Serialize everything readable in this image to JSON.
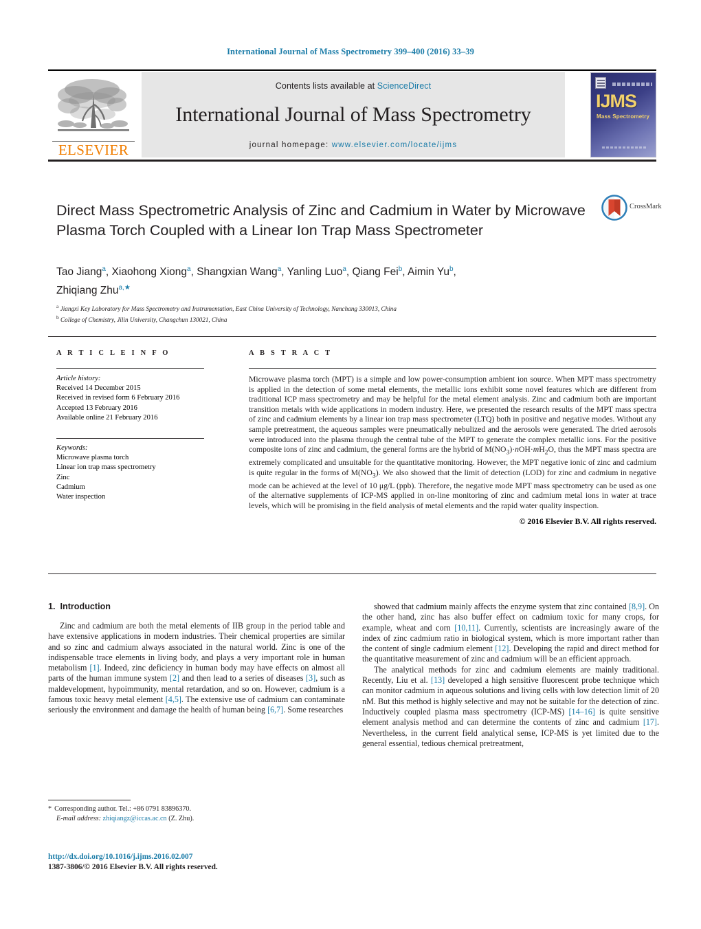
{
  "running_head": "International Journal of Mass Spectrometry 399–400 (2016) 33–39",
  "masthead": {
    "publisher": "ELSEVIER",
    "contents_prefix": "Contents lists available at ",
    "contents_link": "ScienceDirect",
    "journal_name": "International Journal of Mass Spectrometry",
    "homepage_label": "journal homepage: ",
    "homepage_url": "www.elsevier.com/locate/ijms",
    "cover_logo": "IJMS",
    "cover_subtitle": "Mass Spectrometry"
  },
  "article": {
    "title": "Direct Mass Spectrometric Analysis of Zinc and Cadmium in Water by Microwave Plasma Torch Coupled with a Linear Ion Trap Mass Spectrometer",
    "crossmark_label": "CrossMark",
    "authors_line1_parts": [
      {
        "name": "Tao Jiang",
        "sup": "a"
      },
      {
        "name": "Xiaohong Xiong",
        "sup": "a"
      },
      {
        "name": "Shangxian Wang",
        "sup": "a"
      },
      {
        "name": "Yanling Luo",
        "sup": "a"
      },
      {
        "name": "Qiang Fei",
        "sup": "b"
      },
      {
        "name": "Aimin Yu",
        "sup": "b"
      }
    ],
    "authors_line2": {
      "name": "Zhiqiang Zhu",
      "sup": "a,"
    },
    "affiliations": [
      {
        "marker": "a",
        "text": "Jiangxi Key Laboratory for Mass Spectrometry and Instrumentation, East China University of Technology, Nanchang 330013, China"
      },
      {
        "marker": "b",
        "text": "College of Chemistry, Jilin University, Changchun 130021, China"
      }
    ]
  },
  "article_info": {
    "heading": "A R T I C L E   I N F O",
    "history_label": "Article history:",
    "history": [
      "Received 14 December 2015",
      "Received in revised form 6 February 2016",
      "Accepted 13 February 2016",
      "Available online 21 February 2016"
    ],
    "keywords_label": "Keywords:",
    "keywords": [
      "Microwave plasma torch",
      "Linear ion trap mass spectrometry",
      "Zinc",
      "Cadmium",
      "Water inspection"
    ]
  },
  "abstract": {
    "heading": "A B S T R A C T",
    "paragraph_html": "Microwave plasma torch (MPT) is a simple and low power-consumption ambient ion source. When MPT mass spectrometry is applied in the detection of some metal elements, the metallic ions exhibit some novel features which are different from traditional ICP mass spectrometry and may be helpful for the metal element analysis. Zinc and cadmium both are important transition metals with wide applications in modern industry. Here, we presented the research results of the MPT mass spectra of zinc and cadmium elements by a linear ion trap mass spectrometer (LTQ) both in positive and negative modes. Without any sample pretreatment, the aqueous samples were pneumatically nebulized and the aerosols were generated. The dried aerosols were introduced into the plasma through the central tube of the MPT to generate the complex metallic ions. For the positive composite ions of zinc and cadmium, the general forms are the hybrid of M(NO<sub>3</sub>)·<i>n</i>OH·<i>m</i>H<sub>2</sub>O, thus the MPT mass spectra are extremely complicated and unsuitable for the quantitative monitoring. However, the MPT negative ionic of zinc and cadmium is quite regular in the forms of M(NO<sub>3</sub>). We also showed that the limit of detection (LOD) for zinc and cadmium in negative mode can be achieved at the level of 10 μg/L (ppb). Therefore, the negative mode MPT mass spectrometry can be used as one of the alternative supplements of ICP-MS applied in on-line monitoring of zinc and cadmium metal ions in water at trace levels, which will be promising in the field analysis of metal elements and the rapid water quality inspection.",
    "copyright": "© 2016 Elsevier B.V. All rights reserved."
  },
  "introduction": {
    "number": "1.",
    "heading": "Introduction",
    "left_paragraph_html": "Zinc and cadmium are both the metal elements of IIB group in the period table and have extensive applications in modern industries. Their chemical properties are similar and so zinc and cadmium always associated in the natural world. Zinc is one of the indispensable trace elements in living body, and plays a very important role in human metabolism <span class=\"ref\">[1]</span>. Indeed, zinc deficiency in human body may have effects on almost all parts of the human immune system <span class=\"ref\">[2]</span> and then lead to a series of diseases <span class=\"ref\">[3]</span>, such as maldevelopment, hypoimmunity, mental retardation, and so on. However, cadmium is a famous toxic heavy metal element <span class=\"ref\">[4,5]</span>. The extensive use of cadmium can contaminate seriously the environment and damage the health of human being <span class=\"ref\">[6,7]</span>. Some researches",
    "right_paragraph1_html": "showed that cadmium mainly affects the enzyme system that zinc contained <span class=\"ref\">[8,9]</span>. On the other hand, zinc has also buffer effect on cadmium toxic for many crops, for example, wheat and corn <span class=\"ref\">[10,11]</span>. Currently, scientists are increasingly aware of the index of zinc cadmium ratio in biological system, which is more important rather than the content of single cadmium element <span class=\"ref\">[12]</span>. Developing the rapid and direct method for the quantitative measurement of zinc and cadmium will be an efficient approach.",
    "right_paragraph2_html": "The analytical methods for zinc and cadmium elements are mainly traditional. Recently, Liu et al. <span class=\"ref\">[13]</span> developed a high sensitive fluorescent probe technique which can monitor cadmium in aqueous solutions and living cells with low detection limit of 20 nM. But this method is highly selective and may not be suitable for the detection of zinc. Inductively coupled plasma mass spectrometry (ICP-MS) <span class=\"ref\">[14–16]</span> is quite sensitive element analysis method and can determine the contents of zinc and cadmium <span class=\"ref\">[17]</span>. Nevertheless, in the current field analytical sense, ICP-MS is yet limited due to the general essential, tedious chemical pretreatment,"
  },
  "footer": {
    "corresponding_marker": "*",
    "corresponding_text": "Corresponding author. Tel.: +86 0791 83896370.",
    "email_label": "E-mail address:",
    "email": "zhiqiangz@iccas.ac.cn",
    "email_suffix": "(Z. Zhu).",
    "doi_url": "http://dx.doi.org/10.1016/j.ijms.2016.02.007",
    "issn_line": "1387-3806/© 2016 Elsevier B.V. All rights reserved."
  },
  "colors": {
    "link": "#1b7ca8",
    "elsevier_orange": "#f07d00",
    "masthead_bg": "#e6e6e6",
    "text": "#231f20"
  }
}
